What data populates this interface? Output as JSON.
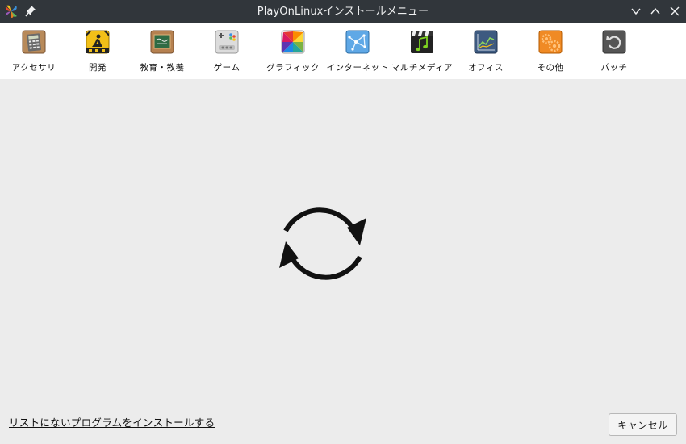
{
  "window": {
    "title": "PlayOnLinuxインストールメニュー"
  },
  "toolbar": {
    "categories": [
      {
        "label": "アクセサリ",
        "icon": "calculator-icon"
      },
      {
        "label": "開発",
        "icon": "construction-sign-icon"
      },
      {
        "label": "教育・教養",
        "icon": "chalkboard-icon"
      },
      {
        "label": "ゲーム",
        "icon": "gamepad-icon"
      },
      {
        "label": "グラフィック",
        "icon": "color-wheel-icon"
      },
      {
        "label": "インターネット",
        "icon": "network-icon"
      },
      {
        "label": "マルチメディア",
        "icon": "clapperboard-music-icon"
      },
      {
        "label": "オフィス",
        "icon": "chart-board-icon"
      },
      {
        "label": "その他",
        "icon": "gears-icon"
      },
      {
        "label": "パッチ",
        "icon": "undo-icon"
      }
    ]
  },
  "main": {
    "loading_icon": "refresh-icon"
  },
  "footer": {
    "install_unlisted_link": "リストにないプログラムをインストールする",
    "cancel_label": "キャンセル"
  },
  "colors": {
    "titlebar_bg": "#31363b",
    "toolbar_bg": "#ffffff",
    "content_bg": "#ececec"
  }
}
